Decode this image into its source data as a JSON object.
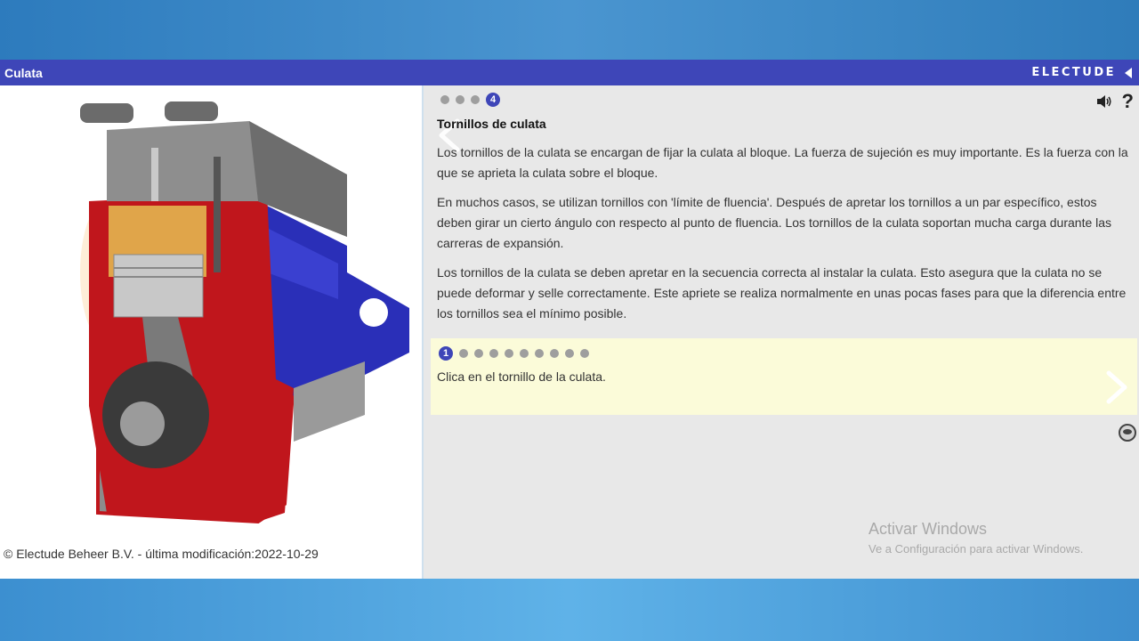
{
  "window": {
    "title": "Culata",
    "brand": "ELECTUDE"
  },
  "left": {
    "image_alt": "engine-cutaway",
    "copyright": "© Electude Beheer B.V. - última modificación:2022-10-29"
  },
  "content": {
    "page_dots": {
      "count": 4,
      "active": 4,
      "active_label": "4"
    },
    "heading": "Tornillos de culata",
    "paragraphs": [
      "Los tornillos de la culata se encargan de fijar la culata al bloque. La fuerza de sujeción es muy importante. Es la fuerza con la que se aprieta la culata sobre el bloque.",
      "En muchos casos, se utilizan tornillos con 'límite de fluencia'. Después de apretar los tornillos a un par específico, estos deben girar un cierto ángulo con respecto al punto de fluencia. Los tornillos de la culata soportan mucha carga durante las carreras de expansión.",
      "Los tornillos de la culata se deben apretar en la secuencia correcta al instalar la culata. Esto asegura que la culata no se puede deformar y selle correctamente. Este apriete se realiza normalmente en unas pocas fases para que la diferencia entre los tornillos sea el mínimo posible."
    ],
    "help_label": "?"
  },
  "task": {
    "dots": {
      "count": 10,
      "active": 1,
      "active_label": "1"
    },
    "instruction": "Clica en el tornillo de la culata."
  },
  "watermark": {
    "line1": "Activar Windows",
    "line2": "Ve a Configuración para activar Windows."
  },
  "colors": {
    "title_bar": "#3e46b8",
    "task_bg": "#fbfbd9",
    "engine_red": "#c0161c",
    "engine_blue": "#2a2fb8"
  }
}
